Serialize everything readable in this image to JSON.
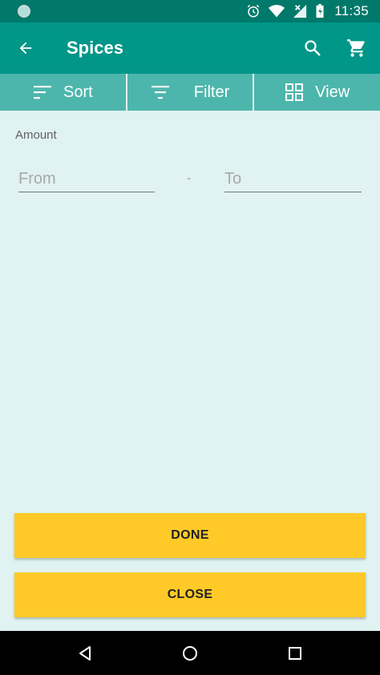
{
  "status_bar": {
    "time": "11:35",
    "icons": [
      "alarm-icon",
      "wifi-icon",
      "signal-icon",
      "battery-icon"
    ]
  },
  "app_bar": {
    "title": "Spices",
    "icons": [
      "back-arrow-icon",
      "search-icon",
      "cart-icon"
    ]
  },
  "toolbar": {
    "sort_label": "Sort",
    "filter_label": "Filter",
    "view_label": "View"
  },
  "filter": {
    "amount_label": "Amount",
    "from_placeholder": "From",
    "separator": "-",
    "to_placeholder": "To"
  },
  "actions": {
    "done_label": "DONE",
    "close_label": "CLOSE"
  },
  "nav_bar": {
    "icons": [
      "nav-back-icon",
      "nav-home-icon",
      "nav-recents-icon"
    ]
  },
  "colors": {
    "status_bar": "#00796b",
    "app_bar": "#009688",
    "toolbar": "#4db6ac",
    "background": "#e0f2f1",
    "button": "#ffca28"
  }
}
